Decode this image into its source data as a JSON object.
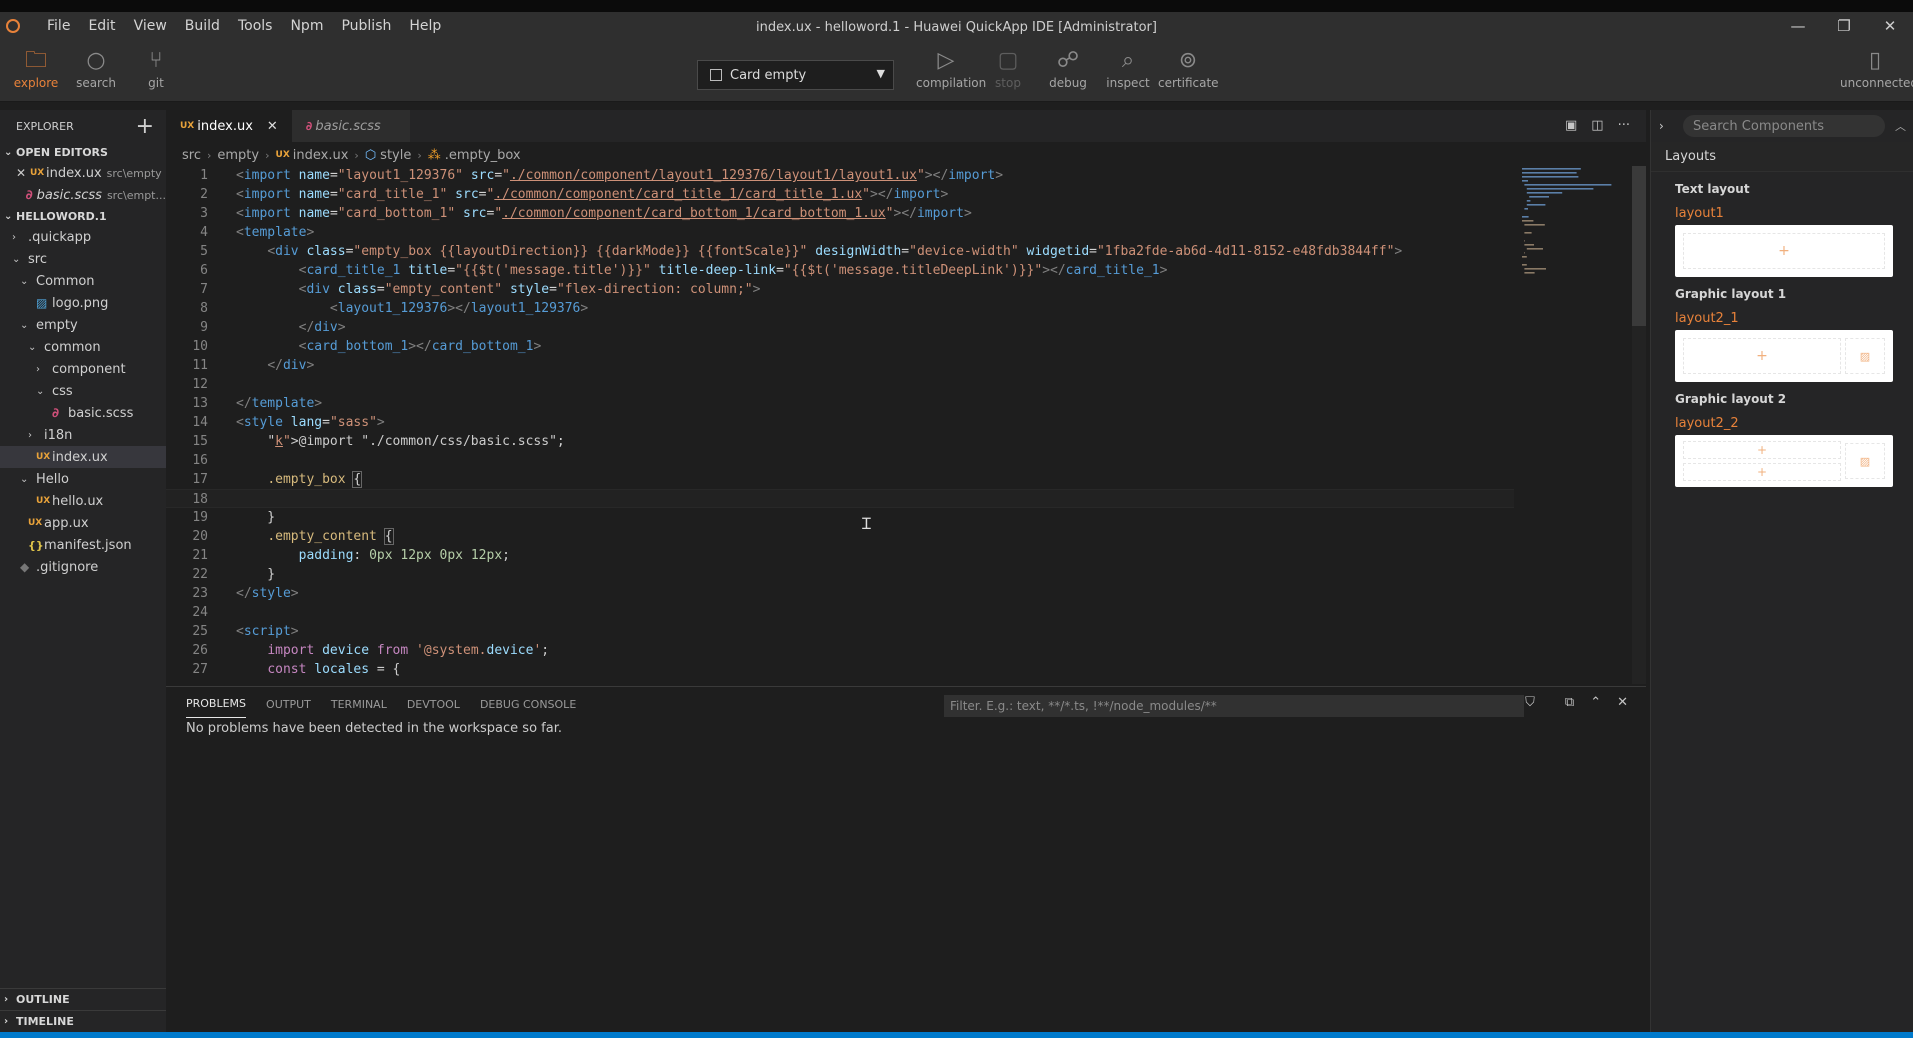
{
  "window": {
    "title": "index.ux - helloword.1 - Huawei QuickApp IDE [Administrator]",
    "menu": [
      "File",
      "Edit",
      "View",
      "Build",
      "Tools",
      "Npm",
      "Publish",
      "Help"
    ],
    "controls": [
      "—",
      "❐",
      "✕"
    ]
  },
  "toolbar": {
    "explore": "explore",
    "search": "search",
    "git": "git",
    "card_select": "Card empty",
    "compilation": "compilation",
    "stop": "stop",
    "debug": "debug",
    "inspect": "inspect",
    "certificate": "certificate",
    "device": "unconnected"
  },
  "sidebar": {
    "title": "EXPLORER",
    "open_editors_title": "OPEN EDITORS",
    "open_editors": [
      {
        "name": "index.ux",
        "desc": "src\\empty",
        "icon": "UX"
      },
      {
        "name": "basic.scss",
        "desc": "src\\empt...",
        "icon": "sass"
      }
    ],
    "project_title": "HELLOWORD.1",
    "tree": [
      {
        "name": ".quickapp",
        "indent": 0,
        "chev": "›",
        "icon": ""
      },
      {
        "name": "src",
        "indent": 0,
        "chev": "⌄",
        "icon": ""
      },
      {
        "name": "Common",
        "indent": 1,
        "chev": "⌄",
        "icon": ""
      },
      {
        "name": "logo.png",
        "indent": 2,
        "chev": "",
        "icon": "img"
      },
      {
        "name": "empty",
        "indent": 1,
        "chev": "⌄",
        "icon": ""
      },
      {
        "name": "common",
        "indent": 2,
        "chev": "⌄",
        "icon": ""
      },
      {
        "name": "component",
        "indent": 3,
        "chev": "›",
        "icon": ""
      },
      {
        "name": "css",
        "indent": 3,
        "chev": "⌄",
        "icon": ""
      },
      {
        "name": "basic.scss",
        "indent": 4,
        "chev": "",
        "icon": "sass"
      },
      {
        "name": "i18n",
        "indent": 2,
        "chev": "›",
        "icon": ""
      },
      {
        "name": "index.ux",
        "indent": 2,
        "chev": "",
        "icon": "UX",
        "selected": true
      },
      {
        "name": "Hello",
        "indent": 1,
        "chev": "⌄",
        "icon": ""
      },
      {
        "name": "hello.ux",
        "indent": 2,
        "chev": "",
        "icon": "UX"
      },
      {
        "name": "app.ux",
        "indent": 1,
        "chev": "",
        "icon": "UX"
      },
      {
        "name": "manifest.json",
        "indent": 1,
        "chev": "",
        "icon": "json"
      },
      {
        "name": ".gitignore",
        "indent": 0,
        "chev": "",
        "icon": "git"
      }
    ],
    "outline": "OUTLINE",
    "timeline": "TIMELINE"
  },
  "editor": {
    "tabs": [
      {
        "label": "index.ux",
        "icon": "UX",
        "active": true
      },
      {
        "label": "basic.scss",
        "icon": "sass",
        "active": false
      }
    ],
    "breadcrumb": [
      "src",
      "empty",
      "index.ux",
      "style",
      ".empty_box"
    ],
    "lines": [
      "<import name=\"layout1_129376\" src=\"./common/component/layout1_129376/layout1/layout1.ux\"></import>",
      "<import name=\"card_title_1\" src=\"./common/component/card_title_1/card_title_1.ux\"></import>",
      "<import name=\"card_bottom_1\" src=\"./common/component/card_bottom_1/card_bottom_1.ux\"></import>",
      "<template>",
      "    <div class=\"empty_box {{layoutDirection}} {{darkMode}} {{fontScale}}\" designWidth=\"device-width\" widgetid=\"1fba2fde-ab6d-4d11-8152-e48fdb3844ff\">",
      "        <card_title_1 title=\"{{$t('message.title')}}\" title-deep-link=\"{{$t('message.titleDeepLink')}}\"></card_title_1>",
      "        <div class=\"empty_content\" style=\"flex-direction: column;\">",
      "            <layout1_129376></layout1_129376>",
      "        </div>",
      "        <card_bottom_1></card_bottom_1>",
      "    </div>",
      "",
      "</template>",
      "<style lang=\"sass\">",
      "    @import \"./common/css/basic.scss\";",
      "",
      "    .empty_box {",
      "",
      "    }",
      "    .empty_content {",
      "        padding: 0px 12px 0px 12px;",
      "    }",
      "</style>",
      "",
      "<script>",
      "    import device from '@system.device';",
      "    const locales = {"
    ]
  },
  "panel": {
    "tabs": [
      "PROBLEMS",
      "OUTPUT",
      "TERMINAL",
      "DEVTOOL",
      "DEBUG CONSOLE"
    ],
    "filter_placeholder": "Filter. E.g.: text, **/*.ts, !**/node_modules/**",
    "message": "No problems have been detected in the workspace so far."
  },
  "components": {
    "search_placeholder": "Search Components",
    "header": "Layouts",
    "groups": [
      {
        "title": "Text layout",
        "item": "layout1"
      },
      {
        "title": "Graphic layout 1",
        "item": "layout2_1"
      },
      {
        "title": "Graphic layout 2",
        "item": "layout2_2"
      }
    ]
  }
}
